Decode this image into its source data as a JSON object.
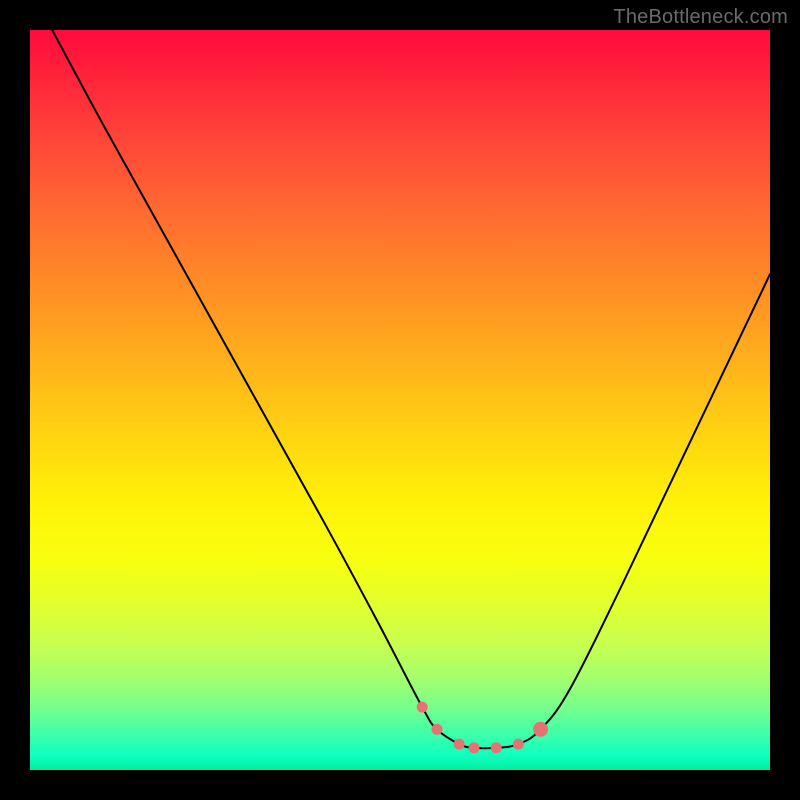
{
  "watermark": "TheBottleneck.com",
  "colors": {
    "curve_stroke": "#000000",
    "marker_fill": "#e57373",
    "marker_stroke": "#e57373",
    "frame": "#000000"
  },
  "chart_data": {
    "type": "line",
    "title": "",
    "xlabel": "",
    "ylabel": "",
    "xlim": [
      0,
      100
    ],
    "ylim": [
      0,
      100
    ],
    "grid": false,
    "series": [
      {
        "name": "bottleneck_curve",
        "x": [
          3,
          10,
          20,
          30,
          40,
          47,
          53,
          55,
          58,
          60,
          63,
          66,
          69,
          73,
          80,
          90,
          100
        ],
        "values": [
          100,
          87,
          69,
          51,
          33,
          20,
          8.5,
          5.5,
          3.5,
          3.0,
          3.0,
          3.5,
          5.5,
          11,
          25,
          46,
          67
        ]
      }
    ],
    "markers": {
      "name": "optimal_zone",
      "x": [
        53,
        55,
        58,
        60,
        63,
        66,
        69
      ],
      "values": [
        8.5,
        5.5,
        3.5,
        3.0,
        3.0,
        3.5,
        5.5
      ],
      "radius": [
        5.5,
        5.5,
        5.5,
        5.5,
        5.5,
        5.5,
        7.5
      ]
    }
  }
}
